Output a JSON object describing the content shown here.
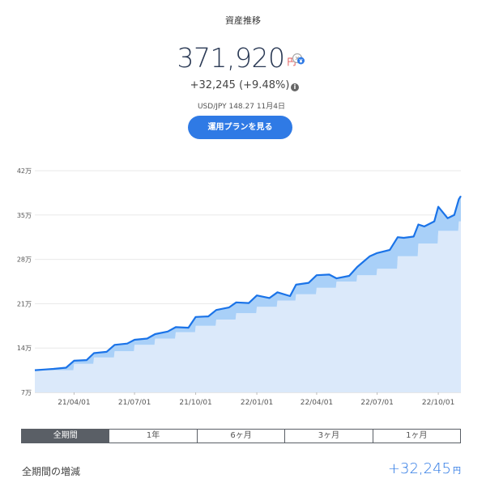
{
  "header": {
    "title": "資産推移",
    "total_value": "371,920",
    "total_unit": "円",
    "diff_text": "+32,245 (+9.48%)",
    "rate_text": "USD/JPY 148.27 11月4日",
    "plan_button_label": "運用プランを見る"
  },
  "tabs": [
    {
      "label": "全期間",
      "active": true
    },
    {
      "label": "1年",
      "active": false
    },
    {
      "label": "6ヶ月",
      "active": false
    },
    {
      "label": "3ヶ月",
      "active": false
    },
    {
      "label": "1ヶ月",
      "active": false
    }
  ],
  "footer": {
    "label": "全期間の増減",
    "value": "+32,245",
    "unit": "円"
  },
  "colors": {
    "accent": "#2f7ae5",
    "line": "#1a73e8",
    "principal_fill": "#dbe9fa",
    "gain_fill": "#a9d0f8"
  },
  "chart_data": {
    "type": "area",
    "y_unit": "万円",
    "y_ticks": [
      7,
      14,
      21,
      28,
      35,
      42
    ],
    "y_tick_labels": [
      "7万",
      "14万",
      "21万",
      "28万",
      "35万",
      "42万"
    ],
    "ylim": [
      7,
      42
    ],
    "x_ticks": [
      "2021-04-01",
      "2021-07-01",
      "2021-10-01",
      "2022-01-01",
      "2022-04-01",
      "2022-07-01",
      "2022-10-01"
    ],
    "x_tick_labels": [
      "21/04/01",
      "21/07/01",
      "21/10/01",
      "22/01/01",
      "22/04/01",
      "22/07/01",
      "22/10/01"
    ],
    "xlim": [
      "2021-02-01",
      "2022-11-04"
    ],
    "grid": true,
    "series": [
      {
        "key": "valuation",
        "x": [
          "2021-02-01",
          "2021-02-15",
          "2021-03-01",
          "2021-03-20",
          "2021-04-01",
          "2021-04-20",
          "2021-05-01",
          "2021-05-20",
          "2021-06-01",
          "2021-06-20",
          "2021-07-01",
          "2021-07-20",
          "2021-08-01",
          "2021-08-20",
          "2021-09-01",
          "2021-09-20",
          "2021-10-01",
          "2021-10-20",
          "2021-11-01",
          "2021-11-20",
          "2021-12-01",
          "2021-12-20",
          "2022-01-01",
          "2022-01-20",
          "2022-02-01",
          "2022-02-20",
          "2022-03-01",
          "2022-03-20",
          "2022-04-01",
          "2022-04-20",
          "2022-05-01",
          "2022-05-20",
          "2022-06-01",
          "2022-06-20",
          "2022-07-01",
          "2022-07-20",
          "2022-08-01",
          "2022-08-10",
          "2022-08-25",
          "2022-09-01",
          "2022-09-10",
          "2022-09-25",
          "2022-10-01",
          "2022-10-15",
          "2022-10-25",
          "2022-11-01",
          "2022-11-04"
        ],
        "values": [
          10.5,
          10.6,
          10.7,
          10.9,
          12.0,
          12.1,
          13.2,
          13.4,
          14.5,
          14.7,
          15.3,
          15.5,
          16.2,
          16.6,
          17.3,
          17.2,
          18.9,
          19.0,
          20.0,
          20.4,
          21.2,
          21.1,
          22.3,
          21.9,
          22.8,
          22.2,
          24.0,
          24.3,
          25.5,
          25.6,
          25.0,
          25.4,
          26.8,
          28.5,
          29.0,
          29.5,
          31.5,
          31.4,
          31.6,
          33.5,
          33.2,
          34.0,
          36.3,
          34.5,
          35.0,
          37.5,
          38.0
        ]
      },
      {
        "key": "principal",
        "x": [
          "2021-02-01",
          "2021-03-31",
          "2021-04-01",
          "2021-04-30",
          "2021-05-01",
          "2021-05-31",
          "2021-06-01",
          "2021-06-30",
          "2021-07-01",
          "2021-07-31",
          "2021-08-01",
          "2021-08-31",
          "2021-09-01",
          "2021-09-30",
          "2021-10-01",
          "2021-10-31",
          "2021-11-01",
          "2021-11-30",
          "2021-12-01",
          "2021-12-31",
          "2022-01-01",
          "2022-01-31",
          "2022-02-01",
          "2022-02-28",
          "2022-03-01",
          "2022-03-31",
          "2022-04-01",
          "2022-04-30",
          "2022-05-01",
          "2022-05-31",
          "2022-06-01",
          "2022-06-30",
          "2022-07-01",
          "2022-07-31",
          "2022-08-01",
          "2022-08-31",
          "2022-09-01",
          "2022-09-30",
          "2022-10-01",
          "2022-10-31",
          "2022-11-01",
          "2022-11-04"
        ],
        "values": [
          10.5,
          10.5,
          11.5,
          11.5,
          12.5,
          12.5,
          13.5,
          13.5,
          14.5,
          14.5,
          15.5,
          15.5,
          16.5,
          16.5,
          17.5,
          17.5,
          18.5,
          18.5,
          19.5,
          19.5,
          20.5,
          20.5,
          21.5,
          21.5,
          22.5,
          22.5,
          23.5,
          23.5,
          24.5,
          24.5,
          25.5,
          25.5,
          26.5,
          26.5,
          28.5,
          28.5,
          30.5,
          30.5,
          32.5,
          32.5,
          34.0,
          34.0
        ]
      }
    ]
  }
}
